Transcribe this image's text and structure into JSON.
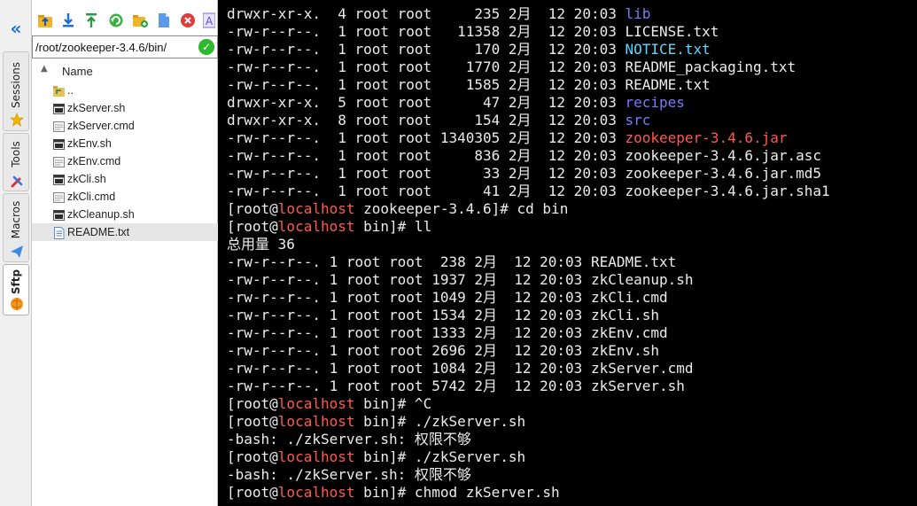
{
  "side_tabs": {
    "collapse_glyph": "«",
    "tabs": [
      {
        "label": "Sessions",
        "icon": "star-icon"
      },
      {
        "label": "Tools",
        "icon": "tools-icon"
      },
      {
        "label": "Macros",
        "icon": "send-icon"
      },
      {
        "label": "Sftp",
        "icon": "sftp-globe-icon",
        "active": true
      }
    ]
  },
  "sftp": {
    "toolbar_icons": [
      "upload-icon",
      "download-icon",
      "upload-up-icon",
      "refresh-icon",
      "new-folder-icon",
      "new-file-icon",
      "delete-icon",
      "rename-icon"
    ],
    "path": "/root/zookeeper-3.4.6/bin/",
    "column_name": "Name",
    "files": [
      {
        "name": "..",
        "type": "parent"
      },
      {
        "name": "zkServer.sh",
        "type": "exe"
      },
      {
        "name": "zkServer.cmd",
        "type": "cmd"
      },
      {
        "name": "zkEnv.sh",
        "type": "exe"
      },
      {
        "name": "zkEnv.cmd",
        "type": "cmd"
      },
      {
        "name": "zkCli.sh",
        "type": "exe"
      },
      {
        "name": "zkCli.cmd",
        "type": "cmd"
      },
      {
        "name": "zkCleanup.sh",
        "type": "exe"
      },
      {
        "name": "README.txt",
        "type": "txt",
        "selected": true
      }
    ]
  },
  "terminal": {
    "colors": {
      "dir": "#7a7aff",
      "archive": "#ff5a4d",
      "special": "#5fd7ff",
      "host": "#ff5a4d",
      "text": "#ececec",
      "background": "#000000"
    },
    "lines": [
      [
        {
          "t": "drwxr-xr-x.  4 root root     235 2月  12 20:03 "
        },
        {
          "t": "lib",
          "c": "blue"
        }
      ],
      [
        {
          "t": "-rw-r--r--.  1 root root   11358 2月  12 20:03 LICENSE.txt"
        }
      ],
      [
        {
          "t": "-rw-r--r--.  1 root root     170 2月  12 20:03 "
        },
        {
          "t": "NOTICE.txt",
          "c": "cyan"
        }
      ],
      [
        {
          "t": "-rw-r--r--.  1 root root    1770 2月  12 20:03 README_packaging.txt"
        }
      ],
      [
        {
          "t": "-rw-r--r--.  1 root root    1585 2月  12 20:03 README.txt"
        }
      ],
      [
        {
          "t": "drwxr-xr-x.  5 root root      47 2月  12 20:03 "
        },
        {
          "t": "recipes",
          "c": "blue"
        }
      ],
      [
        {
          "t": "drwxr-xr-x.  8 root root     154 2月  12 20:03 "
        },
        {
          "t": "src",
          "c": "blue"
        }
      ],
      [
        {
          "t": "-rw-r--r--.  1 root root 1340305 2月  12 20:03 "
        },
        {
          "t": "zookeeper-3.4.6.jar",
          "c": "red"
        }
      ],
      [
        {
          "t": "-rw-r--r--.  1 root root     836 2月  12 20:03 zookeeper-3.4.6.jar.asc"
        }
      ],
      [
        {
          "t": "-rw-r--r--.  1 root root      33 2月  12 20:03 zookeeper-3.4.6.jar.md5"
        }
      ],
      [
        {
          "t": "-rw-r--r--.  1 root root      41 2月  12 20:03 zookeeper-3.4.6.jar.sha1"
        }
      ],
      [
        {
          "t": "[root@"
        },
        {
          "t": "localhost",
          "c": "host"
        },
        {
          "t": " zookeeper-3.4.6]# cd bin"
        }
      ],
      [
        {
          "t": "[root@"
        },
        {
          "t": "localhost",
          "c": "host"
        },
        {
          "t": " bin]# ll"
        }
      ],
      [
        {
          "t": "总用量 36"
        }
      ],
      [
        {
          "t": "-rw-r--r--. 1 root root  238 2月  12 20:03 README.txt"
        }
      ],
      [
        {
          "t": "-rw-r--r--. 1 root root 1937 2月  12 20:03 zkCleanup.sh"
        }
      ],
      [
        {
          "t": "-rw-r--r--. 1 root root 1049 2月  12 20:03 zkCli.cmd"
        }
      ],
      [
        {
          "t": "-rw-r--r--. 1 root root 1534 2月  12 20:03 zkCli.sh"
        }
      ],
      [
        {
          "t": "-rw-r--r--. 1 root root 1333 2月  12 20:03 zkEnv.cmd"
        }
      ],
      [
        {
          "t": "-rw-r--r--. 1 root root 2696 2月  12 20:03 zkEnv.sh"
        }
      ],
      [
        {
          "t": "-rw-r--r--. 1 root root 1084 2月  12 20:03 zkServer.cmd"
        }
      ],
      [
        {
          "t": "-rw-r--r--. 1 root root 5742 2月  12 20:03 zkServer.sh"
        }
      ],
      [
        {
          "t": "[root@"
        },
        {
          "t": "localhost",
          "c": "host"
        },
        {
          "t": " bin]# ^C"
        }
      ],
      [
        {
          "t": "[root@"
        },
        {
          "t": "localhost",
          "c": "host"
        },
        {
          "t": " bin]# ./zkServer.sh"
        }
      ],
      [
        {
          "t": "-bash: ./zkServer.sh: 权限不够"
        }
      ],
      [
        {
          "t": "[root@"
        },
        {
          "t": "localhost",
          "c": "host"
        },
        {
          "t": " bin]# ./zkServer.sh"
        }
      ],
      [
        {
          "t": "-bash: ./zkServer.sh: 权限不够"
        }
      ],
      [
        {
          "t": "[root@"
        },
        {
          "t": "localhost",
          "c": "host"
        },
        {
          "t": " bin]# chmod zkServer.sh"
        }
      ]
    ]
  }
}
